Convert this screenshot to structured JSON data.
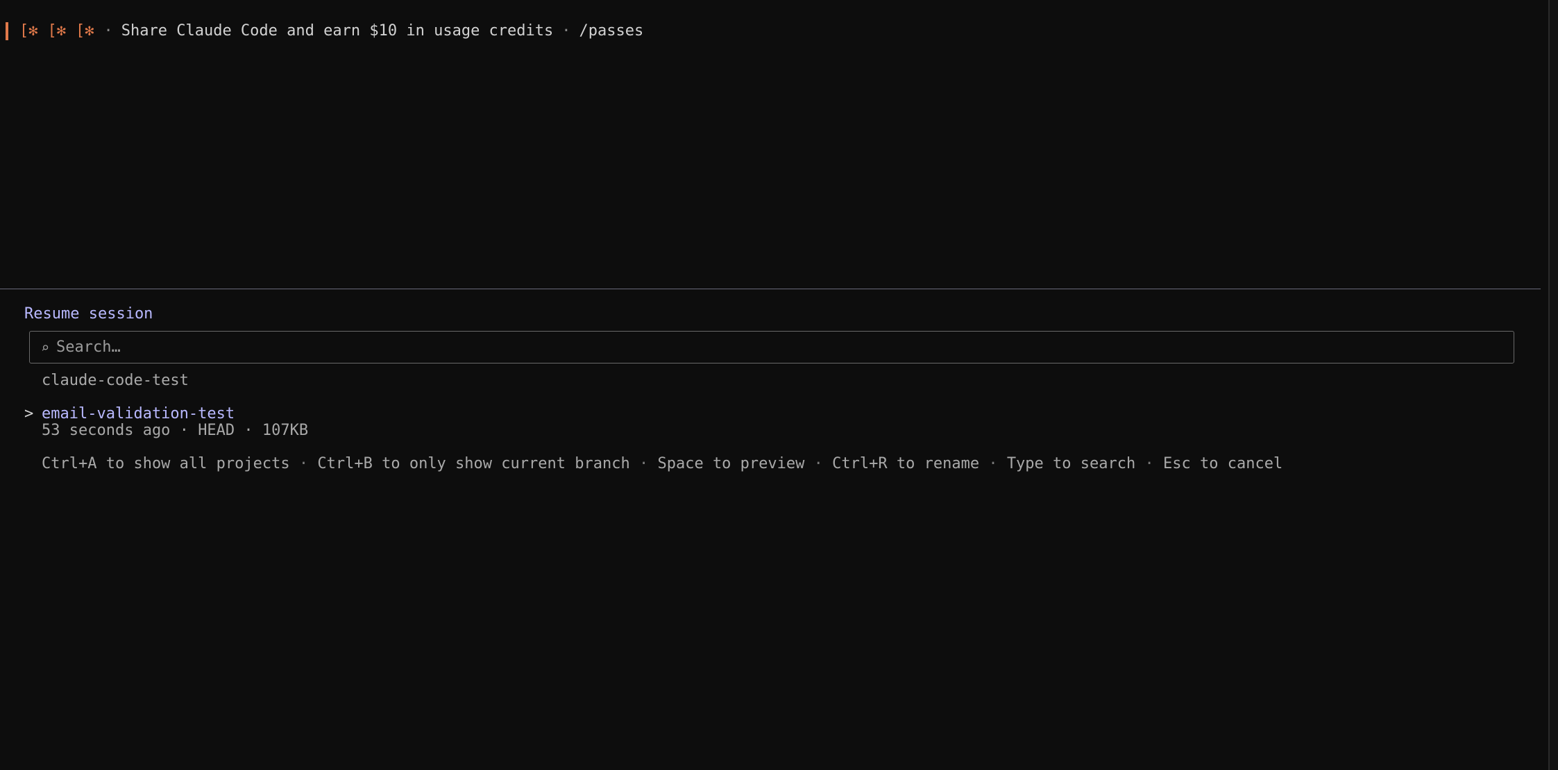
{
  "banner": {
    "glyphs": [
      "[✻",
      "[✻",
      "[✻"
    ],
    "separator": "·",
    "promo_text": "Share Claude Code and earn $10 in usage credits",
    "command": "/passes",
    "accent_color": "#e0794a"
  },
  "resume": {
    "title": "Resume session",
    "search": {
      "icon": "search-icon",
      "placeholder": "Search…",
      "value": ""
    },
    "group_header": "claude-code-test",
    "sessions": [
      {
        "selected": true,
        "indicator": ">",
        "name": "email-validation-test",
        "age": "53 seconds ago",
        "branch": "HEAD",
        "size": "107KB"
      }
    ],
    "meta_separator": "·",
    "hints": [
      "Ctrl+A to show all projects",
      "Ctrl+B to only show current branch",
      "Space to preview",
      "Ctrl+R to rename",
      "Type to search",
      "Esc to cancel"
    ],
    "hint_separator": "·"
  },
  "colors": {
    "background": "#0d0d0d",
    "title": "#b9b9ff",
    "muted": "#a9a9a9",
    "divider": "#6a6a7a"
  }
}
